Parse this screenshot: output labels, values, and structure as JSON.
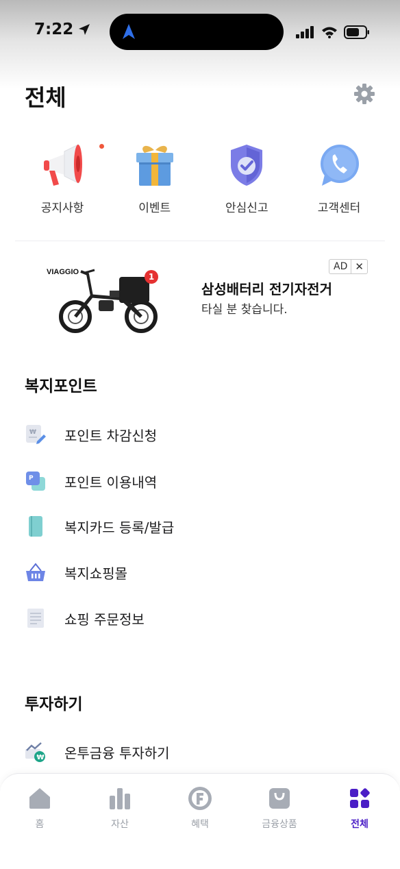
{
  "status": {
    "time": "7:22"
  },
  "header": {
    "title": "전체"
  },
  "quick_menu": [
    {
      "label": "공지사항",
      "icon": "megaphone-icon"
    },
    {
      "label": "이벤트",
      "icon": "gift-icon"
    },
    {
      "label": "안심신고",
      "icon": "shield-check-icon"
    },
    {
      "label": "고객센터",
      "icon": "phone-bubble-icon"
    }
  ],
  "ad": {
    "brand": "VIAGGIO",
    "badge_count": "1",
    "title": "삼성배터리 전기자전거",
    "subtitle": "타실 분 찾습니다.",
    "ad_label": "AD",
    "close_label": "✕"
  },
  "welfare": {
    "title": "복지포인트",
    "items": [
      {
        "label": "포인트 차감신청",
        "icon": "won-document-icon"
      },
      {
        "label": "포인트 이용내역",
        "icon": "point-cards-icon"
      },
      {
        "label": "복지카드 등록/발급",
        "icon": "card-icon"
      },
      {
        "label": "복지쇼핑몰",
        "icon": "basket-icon"
      },
      {
        "label": "쇼핑 주문정보",
        "icon": "receipt-icon"
      }
    ]
  },
  "invest": {
    "title": "투자하기",
    "items": [
      {
        "label": "온투금융 투자하기",
        "icon": "chart-money-icon"
      }
    ]
  },
  "tab_bar": {
    "tabs": [
      {
        "label": "홈",
        "icon": "home-icon",
        "active": false
      },
      {
        "label": "자산",
        "icon": "bar-chart-icon",
        "active": false
      },
      {
        "label": "혜택",
        "icon": "f-coin-icon",
        "active": false
      },
      {
        "label": "금융상품",
        "icon": "bag-icon",
        "active": false
      },
      {
        "label": "전체",
        "icon": "grid-icon",
        "active": true
      }
    ]
  },
  "colors": {
    "accent": "#4a1dc6",
    "inactive": "#9ba0a8",
    "notice_dot": "#f0583c"
  }
}
